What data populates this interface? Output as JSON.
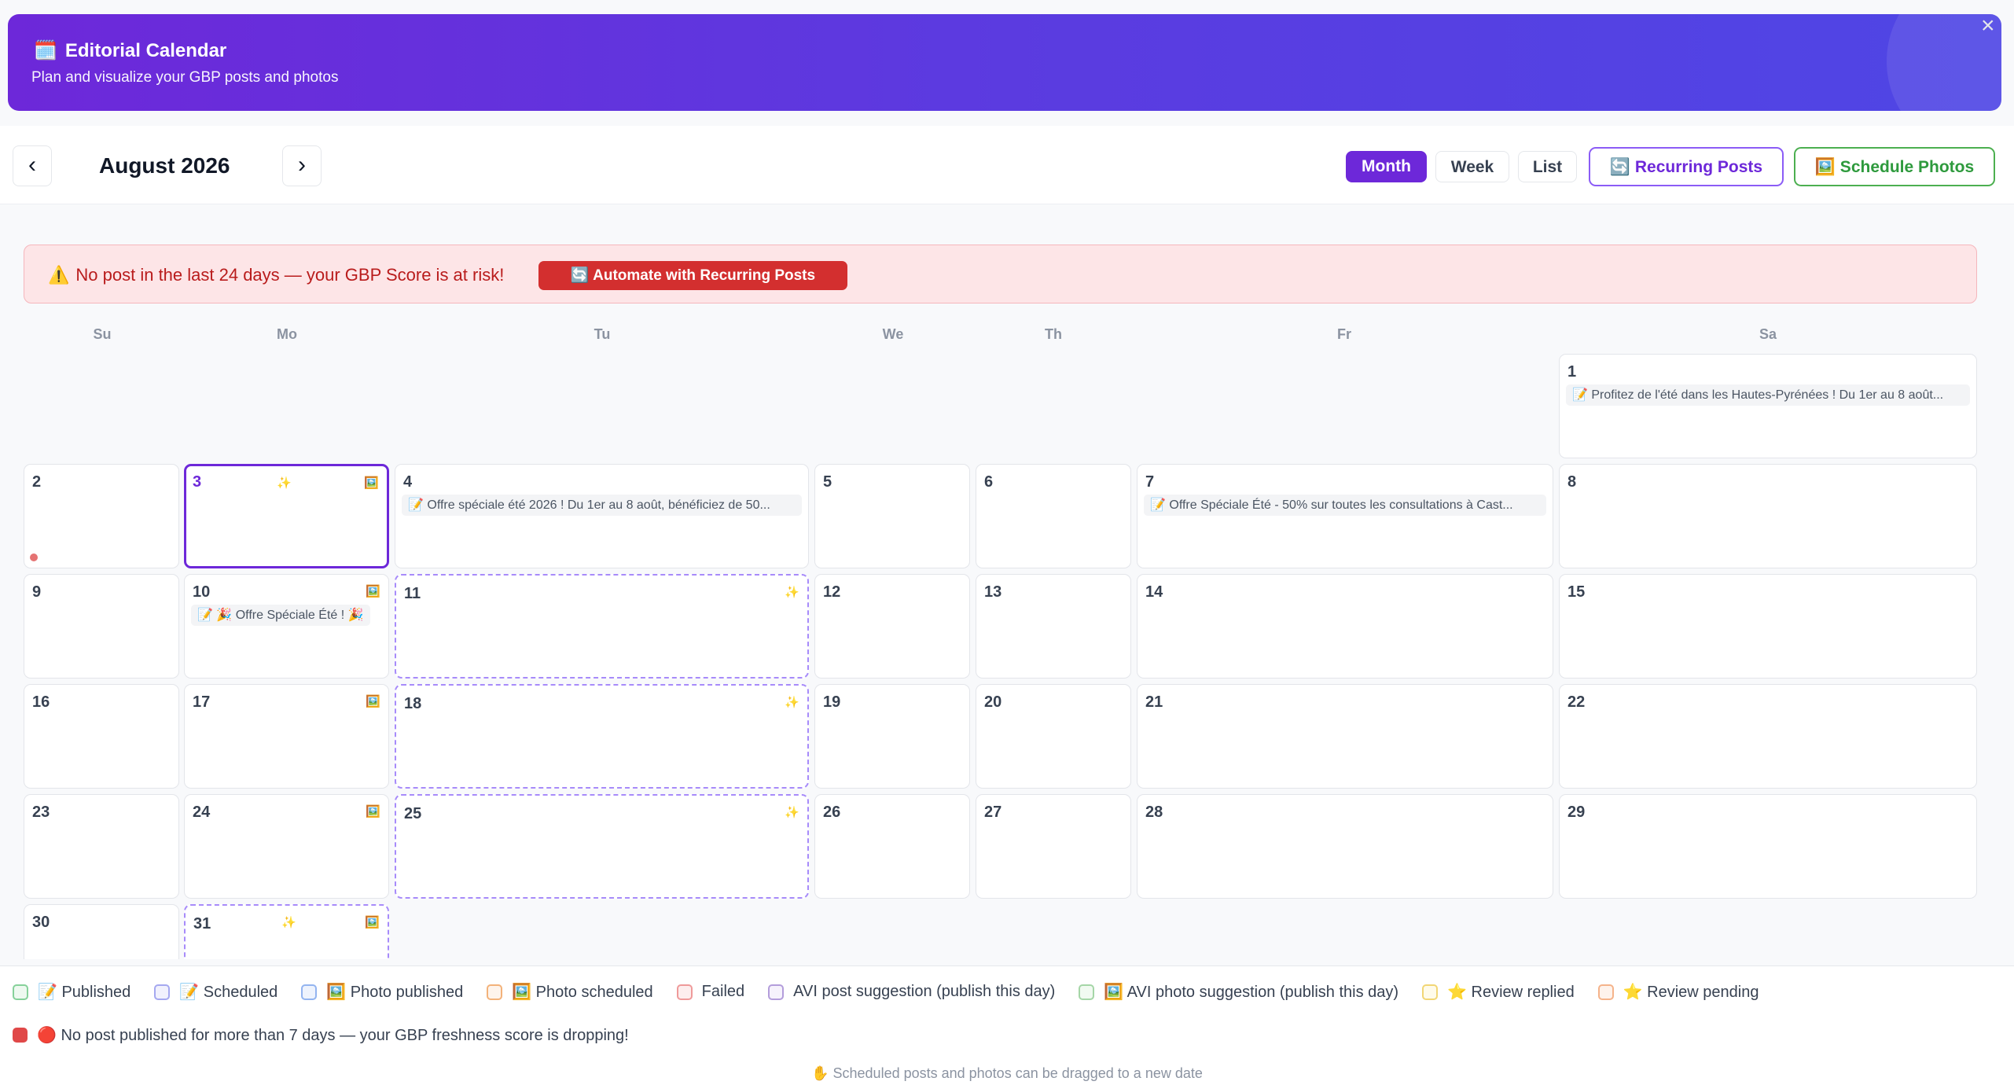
{
  "header": {
    "title_icon": "🗓️",
    "title": "Editorial Calendar",
    "subtitle": "Plan and visualize your GBP posts and photos",
    "close_symbol": "×"
  },
  "toolbar": {
    "prev": "‹",
    "next": "›",
    "month_label": "August 2026",
    "views": [
      "Month",
      "Week",
      "List"
    ],
    "active_view": "Month",
    "recurring_label": "🔄 Recurring Posts",
    "schedule_photos_label": "🖼️ Schedule Photos"
  },
  "alert": {
    "icon": "⚠️",
    "message": "No post in the last 24 days — your GBP Score is at risk!",
    "button": "🔄 Automate with Recurring Posts"
  },
  "calendar": {
    "weekdays": [
      "Su",
      "Mo",
      "Tu",
      "We",
      "Th",
      "Fr",
      "Sa"
    ],
    "days": {
      "d1": "1",
      "d2": "2",
      "d3": "3",
      "d4": "4",
      "d5": "5",
      "d6": "6",
      "d7": "7",
      "d8": "8",
      "d9": "9",
      "d10": "10",
      "d11": "11",
      "d12": "12",
      "d13": "13",
      "d14": "14",
      "d15": "15",
      "d16": "16",
      "d17": "17",
      "d18": "18",
      "d19": "19",
      "d20": "20",
      "d21": "21",
      "d22": "22",
      "d23": "23",
      "d24": "24",
      "d25": "25",
      "d26": "26",
      "d27": "27",
      "d28": "28",
      "d29": "29",
      "d30": "30",
      "d31": "31"
    },
    "events": {
      "aug1": "📝 Profitez de l'été dans les Hautes-Pyrénées ! Du 1er au 8 août...",
      "aug4": "📝 Offre spéciale été 2026 ! Du 1er au 8 août, bénéficiez de 50...",
      "aug7": "📝 Offre Spéciale Été - 50% sur toutes les consultations à Cast...",
      "aug10": "📝 🎉 Offre Spéciale Été ! 🎉"
    },
    "photo_marker": "🖼️",
    "suggestion_marker": "✨"
  },
  "legend": {
    "items": [
      {
        "label": "📝 Published",
        "color": "#86d19a"
      },
      {
        "label": "📝 Scheduled",
        "color": "#a5a8f0"
      },
      {
        "label": "🖼️ Photo published",
        "color": "#93b4f0"
      },
      {
        "label": "🖼️ Photo scheduled",
        "color": "#f3b27a"
      },
      {
        "label": "Failed",
        "color": "#ef9a9a"
      },
      {
        "label": "AVI post suggestion (publish this day)",
        "color": "#b39ddb"
      },
      {
        "label": "🖼️ AVI photo suggestion (publish this day)",
        "color": "#a5d6a7"
      },
      {
        "label": "⭐ Review replied",
        "color": "#f2d675"
      },
      {
        "label": "⭐ Review pending",
        "color": "#f5b38a"
      }
    ],
    "warning": "🔴 No post published for more than 7 days — your GBP freshness score is dropping!",
    "hint": "✋ Scheduled posts and photos can be dragged to a new date"
  }
}
